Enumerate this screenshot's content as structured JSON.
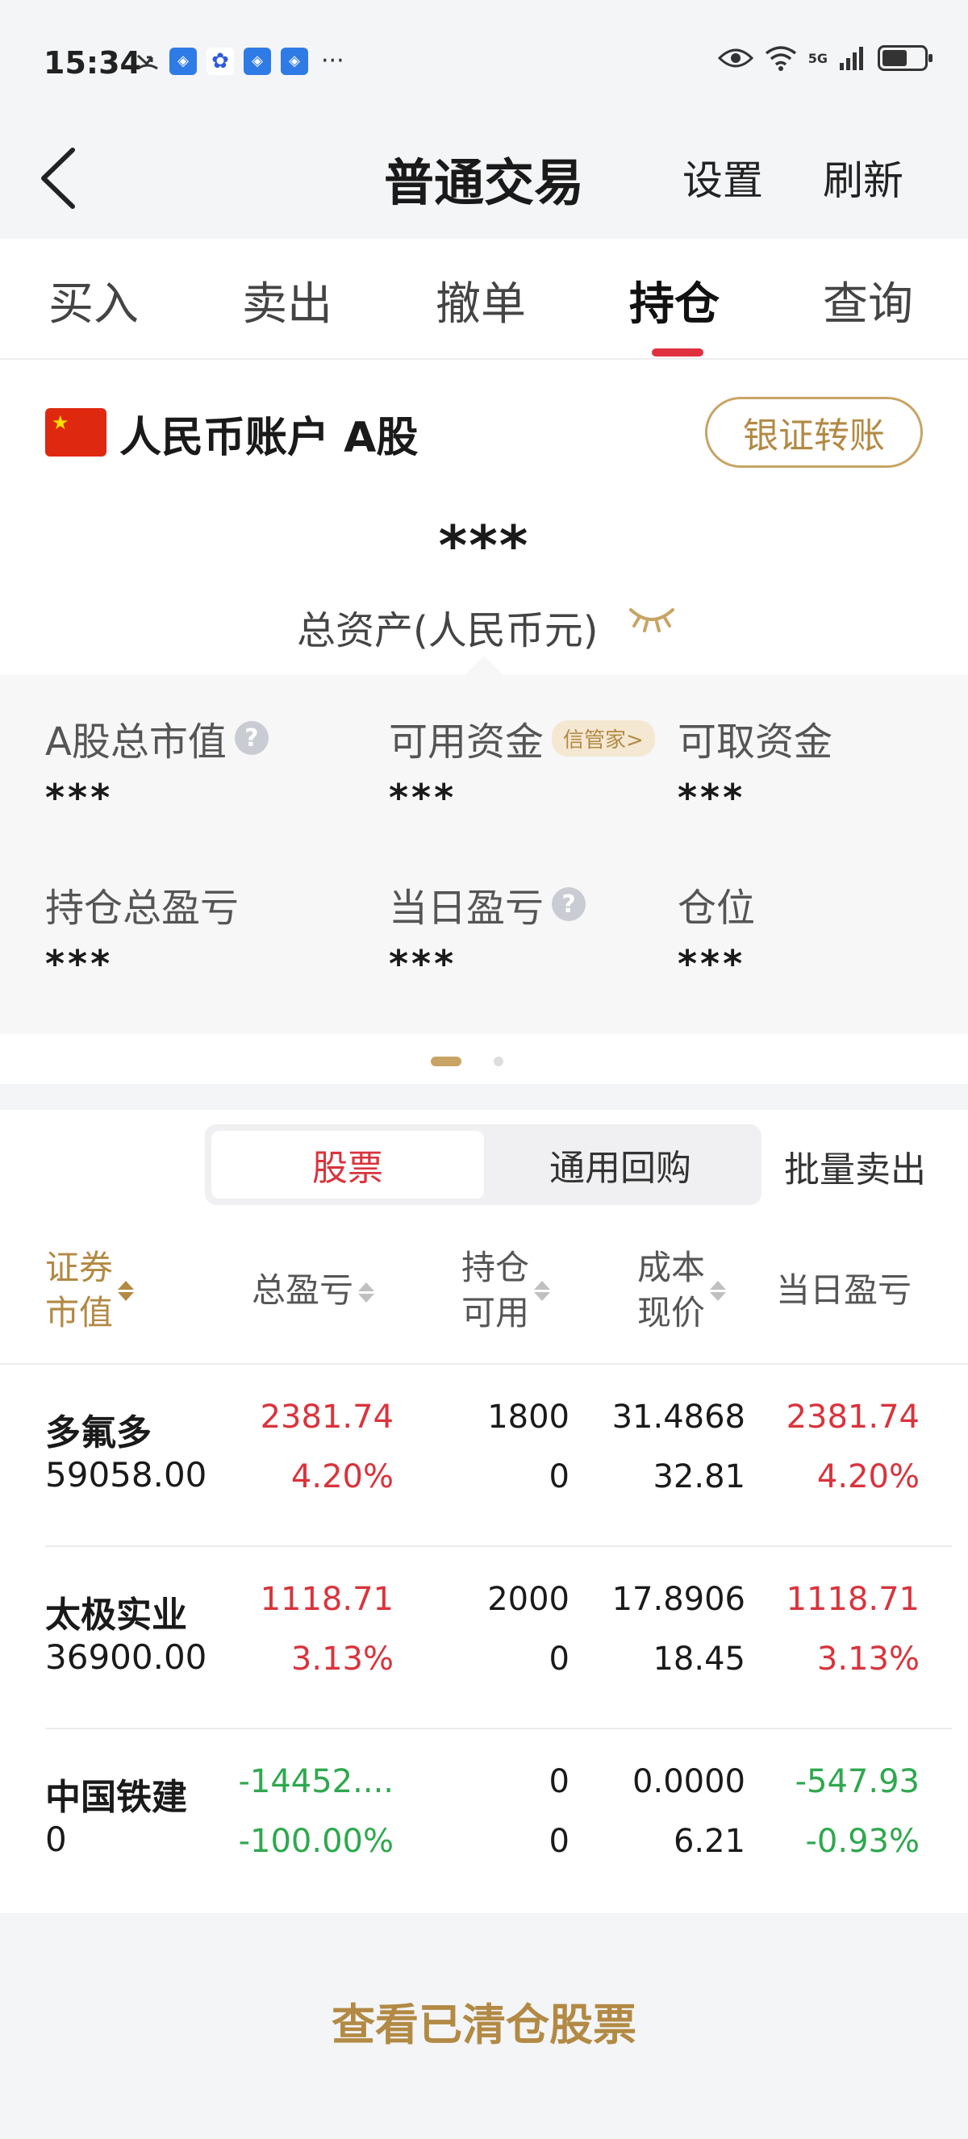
{
  "status_bar": {
    "time": "15:34",
    "more": "···",
    "network": "5G"
  },
  "header": {
    "title": "普通交易",
    "settings_label": "设置",
    "refresh_label": "刷新"
  },
  "tabs": [
    "买入",
    "卖出",
    "撤单",
    "持仓",
    "查询"
  ],
  "active_tab": "持仓",
  "account": {
    "name": "人民币账户 A股",
    "transfer_label": "银证转账",
    "total_assets_value": "***",
    "total_assets_label": "总资产(人民币元)"
  },
  "metrics": [
    {
      "label": "A股总市值",
      "value": "***",
      "help": "?"
    },
    {
      "label": "可用资金",
      "badge": "信管家>",
      "value": "***"
    },
    {
      "label": "可取资金",
      "value": "***"
    },
    {
      "label": "持仓总盈亏",
      "value": "***"
    },
    {
      "label": "当日盈亏",
      "value": "***",
      "help": "?"
    },
    {
      "label": "仓位",
      "value": "***"
    }
  ],
  "positions": {
    "segments": [
      "股票",
      "通用回购"
    ],
    "active_segment": "股票",
    "batch_sell_label": "批量卖出",
    "columns": {
      "c1_top": "证券",
      "c1_bottom": "市值",
      "c2": "总盈亏",
      "c3_top": "持仓",
      "c3_bottom": "可用",
      "c4_top": "成本",
      "c4_bottom": "现价",
      "c5": "当日盈亏"
    },
    "rows": [
      {
        "name": "多氟多",
        "market_value": "59058.00",
        "total_pl": "2381.74",
        "total_pl_pct": "4.20%",
        "holding": "1800",
        "available": "0",
        "cost": "31.4868",
        "price": "32.81",
        "day_pl": "2381.74",
        "day_pl_pct": "4.20%"
      },
      {
        "name": "太极实业",
        "market_value": "36900.00",
        "total_pl": "1118.71",
        "total_pl_pct": "3.13%",
        "holding": "2000",
        "available": "0",
        "cost": "17.8906",
        "price": "18.45",
        "day_pl": "1118.71",
        "day_pl_pct": "3.13%"
      },
      {
        "name": "中国铁建",
        "market_value": "0",
        "total_pl": "-14452....",
        "total_pl_pct": "-100.00%",
        "holding": "0",
        "available": "0",
        "cost": "0.0000",
        "price": "6.21",
        "day_pl": "-547.93",
        "day_pl_pct": "-0.93%"
      }
    ]
  },
  "footer": {
    "cleared_link": "查看已清仓股票"
  },
  "colors": {
    "up": "#d9343d",
    "down": "#2fa84f",
    "gold": "#b28a45",
    "accent": "#e0323e"
  }
}
